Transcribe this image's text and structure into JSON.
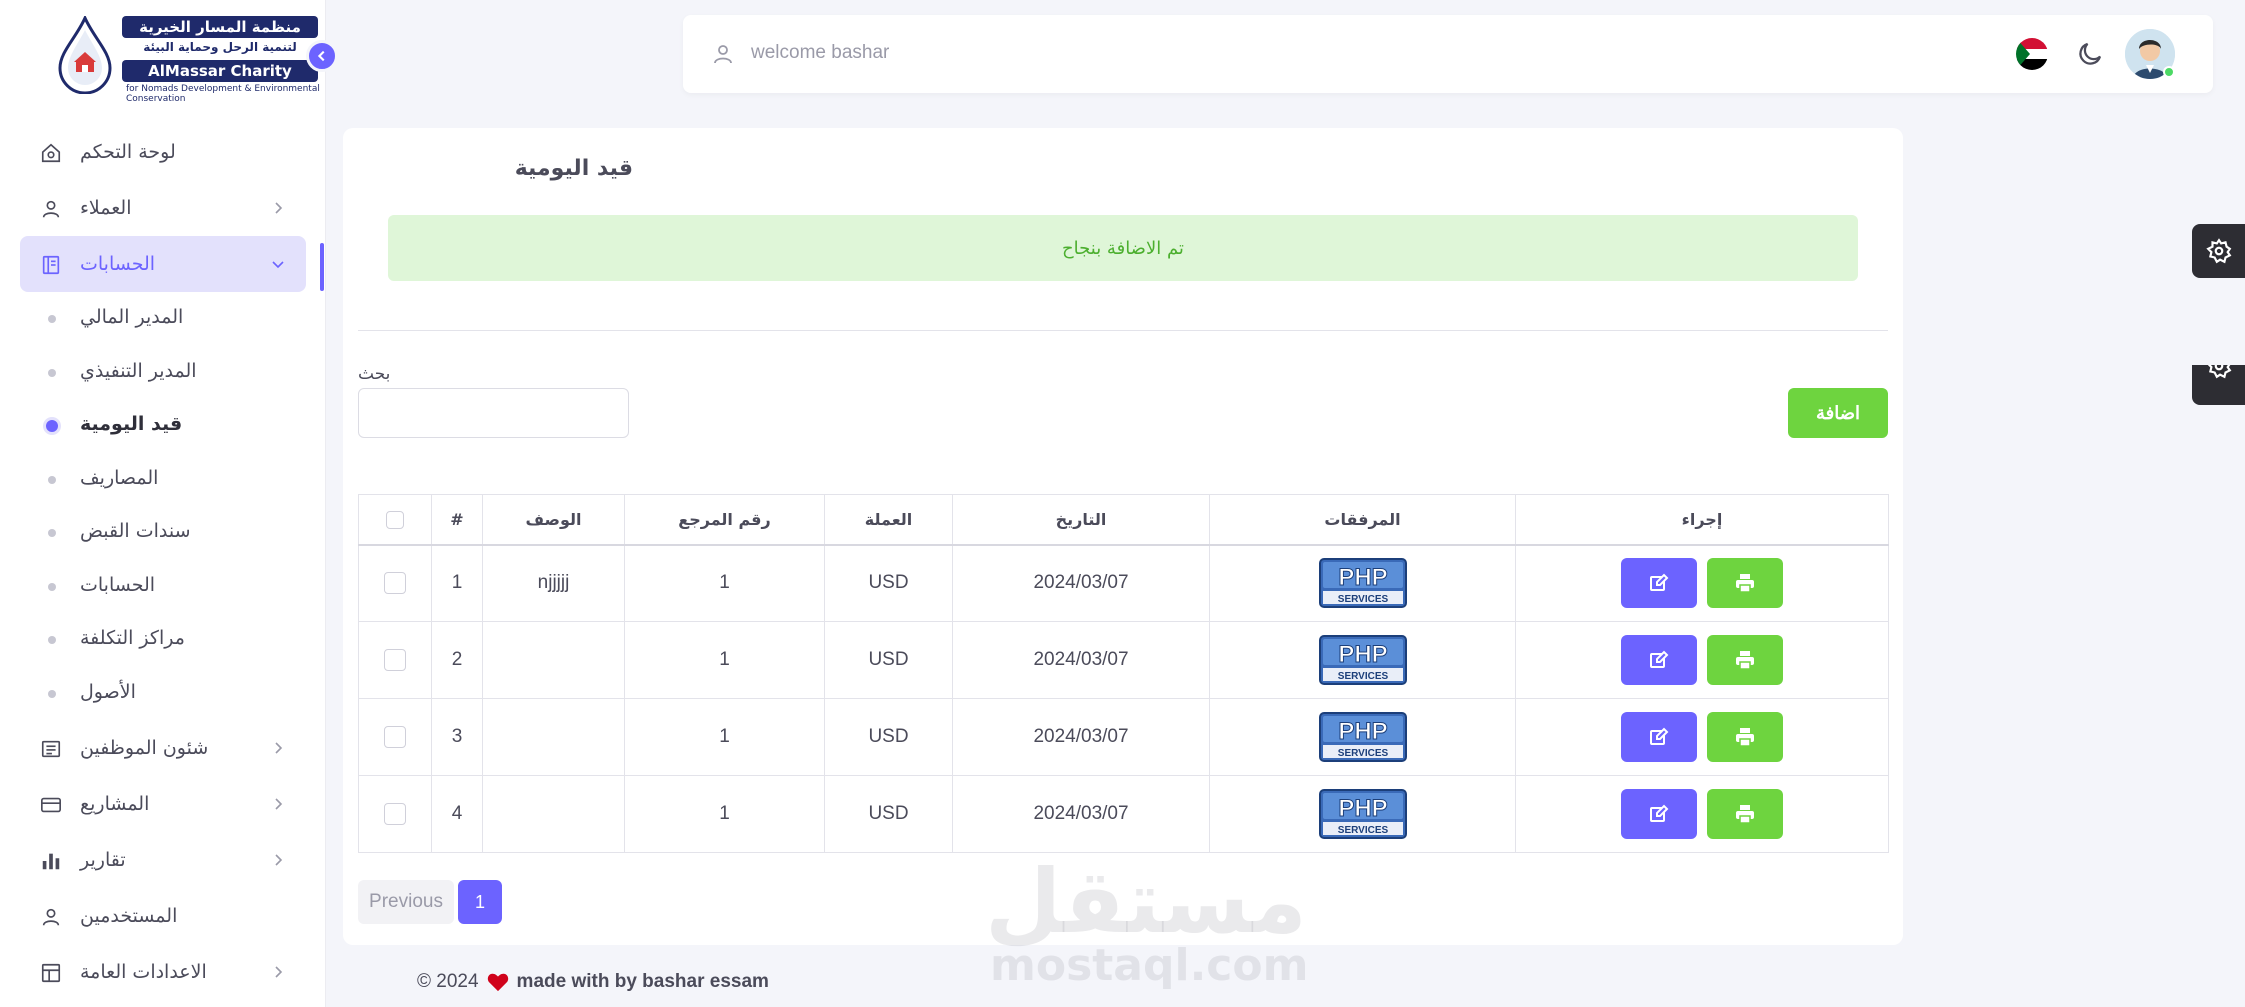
{
  "logo": {
    "arabic_name": "منظمة المسار الخيرية",
    "arabic_tagline": "لتنمية الرحل وحماية البيئة",
    "english_name": "AlMassar Charity",
    "english_tagline": "for Nomads Development & Environmental Conservation"
  },
  "sidebar": {
    "items": [
      {
        "label": "لوحة التحكم",
        "icon": "home-icon"
      },
      {
        "label": "العملاء",
        "icon": "user-icon"
      },
      {
        "label": "الحسابات",
        "icon": "book-icon"
      },
      {
        "label": "شئون الموظفين",
        "icon": "document-icon"
      },
      {
        "label": "المشاريع",
        "icon": "credit-card-icon"
      },
      {
        "label": "تقارير",
        "icon": "bar-chart-icon"
      },
      {
        "label": "المستخدمين",
        "icon": "user-icon"
      },
      {
        "label": "الاعدادات العامة",
        "icon": "layout-icon"
      }
    ],
    "subitems": [
      {
        "label": "المدير المالي"
      },
      {
        "label": "المدير التنفيذي"
      },
      {
        "label": "قيد اليومية"
      },
      {
        "label": "المصاريف"
      },
      {
        "label": "سندات القبض"
      },
      {
        "label": "الحسابات"
      },
      {
        "label": "مراكز التكلفة"
      },
      {
        "label": "الأصول"
      }
    ]
  },
  "topbar": {
    "welcome": "welcome bashar"
  },
  "page": {
    "title": "قيد اليومية",
    "alert": "تم الاضافة بنجاح",
    "search_label": "بحث",
    "add_button": "اضافة"
  },
  "table": {
    "headers": {
      "actions": "إجراء",
      "attachments": "المرفقات",
      "date": "التاريخ",
      "currency": "العملة",
      "ref": "رقم المرجع",
      "desc": "الوصف",
      "num": "#"
    },
    "rows": [
      {
        "date": "2024/03/07",
        "currency": "USD",
        "ref": "1",
        "desc": "njjjjj",
        "num": "1"
      },
      {
        "date": "2024/03/07",
        "currency": "USD",
        "ref": "1",
        "desc": "",
        "num": "2"
      },
      {
        "date": "2024/03/07",
        "currency": "USD",
        "ref": "1",
        "desc": "",
        "num": "3"
      },
      {
        "date": "2024/03/07",
        "currency": "USD",
        "ref": "1",
        "desc": "",
        "num": "4"
      }
    ]
  },
  "pagination": {
    "previous": "Previous",
    "current": "1"
  },
  "footer": {
    "copyright": "© 2024",
    "made_with": "made with by bashar essam"
  },
  "watermark": {
    "arabic": "مستقل",
    "latin": "mostaql.com"
  },
  "colors": {
    "accent": "#6c63ff",
    "success": "#6ed43f",
    "alert_bg": "#dff6d8"
  }
}
